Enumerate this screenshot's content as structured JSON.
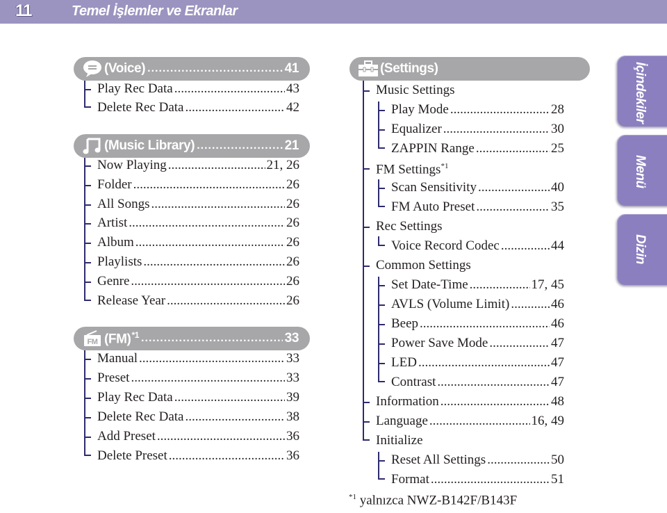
{
  "header": {
    "page_number": "11",
    "title": "Temel İşlemler ve Ekranlar"
  },
  "sections": {
    "voice": {
      "icon": "voice-speech-bubble-icon",
      "label": "(Voice)",
      "page": "41",
      "items": [
        {
          "label": "Play Rec Data",
          "page": "43"
        },
        {
          "label": "Delete Rec Data",
          "page": "42"
        }
      ]
    },
    "music": {
      "icon": "music-note-icon",
      "label": "(Music Library)",
      "page": "21",
      "items": [
        {
          "label": "Now Playing",
          "page": "21, 26"
        },
        {
          "label": "Folder",
          "page": "26"
        },
        {
          "label": "All Songs",
          "page": "26"
        },
        {
          "label": "Artist",
          "page": "26"
        },
        {
          "label": "Album",
          "page": "26"
        },
        {
          "label": "Playlists",
          "page": "26"
        },
        {
          "label": "Genre",
          "page": "26"
        },
        {
          "label": "Release Year",
          "page": "26"
        }
      ]
    },
    "fm": {
      "icon": "fm-radio-icon",
      "label": "(FM)",
      "footnote_mark": "*1",
      "page": "33",
      "items": [
        {
          "label": "Manual",
          "page": "33"
        },
        {
          "label": "Preset",
          "page": "33"
        },
        {
          "label": "Play Rec Data",
          "page": "39"
        },
        {
          "label": "Delete Rec Data",
          "page": "38"
        },
        {
          "label": "Add Preset",
          "page": "36"
        },
        {
          "label": "Delete Preset",
          "page": "36"
        }
      ]
    },
    "settings": {
      "icon": "toolbox-icon",
      "label": "(Settings)",
      "groups": [
        {
          "label": "Music Settings",
          "items": [
            {
              "label": "Play Mode",
              "page": "28"
            },
            {
              "label": "Equalizer",
              "page": "30"
            },
            {
              "label": "ZAPPIN Range",
              "page": "25"
            }
          ]
        },
        {
          "label": "FM Settings",
          "footnote_mark": "*1",
          "items": [
            {
              "label": "Scan Sensitivity",
              "page": "40"
            },
            {
              "label": "FM Auto Preset",
              "page": "35"
            }
          ]
        },
        {
          "label": "Rec Settings",
          "items": [
            {
              "label": "Voice Record Codec",
              "page": "44"
            }
          ]
        },
        {
          "label": "Common Settings",
          "items": [
            {
              "label": "Set Date-Time",
              "page": "17, 45"
            },
            {
              "label": "AVLS (Volume Limit)",
              "page": "46"
            },
            {
              "label": "Beep",
              "page": "46"
            },
            {
              "label": "Power Save Mode",
              "page": "47"
            },
            {
              "label": "LED",
              "page": "47"
            },
            {
              "label": "Contrast",
              "page": "47"
            }
          ]
        },
        {
          "label": "Information",
          "page": "48"
        },
        {
          "label": "Language",
          "page": "16, 49"
        },
        {
          "label": "Initialize",
          "items": [
            {
              "label": "Reset All Settings",
              "page": "50"
            },
            {
              "label": "Format",
              "page": "51"
            }
          ]
        }
      ]
    }
  },
  "side_tabs": [
    {
      "label": "İçindekiler"
    },
    {
      "label": "Menü"
    },
    {
      "label": "Dizin"
    }
  ],
  "footnote": {
    "mark": "*1",
    "text": " yalnızca NWZ-B142F/B143F"
  },
  "colors": {
    "header_bg": "#9b94c0",
    "pill_bg": "#a7a7a9",
    "tree_line": "#2e2a6e",
    "tab_bg": "#8b7fbf"
  }
}
